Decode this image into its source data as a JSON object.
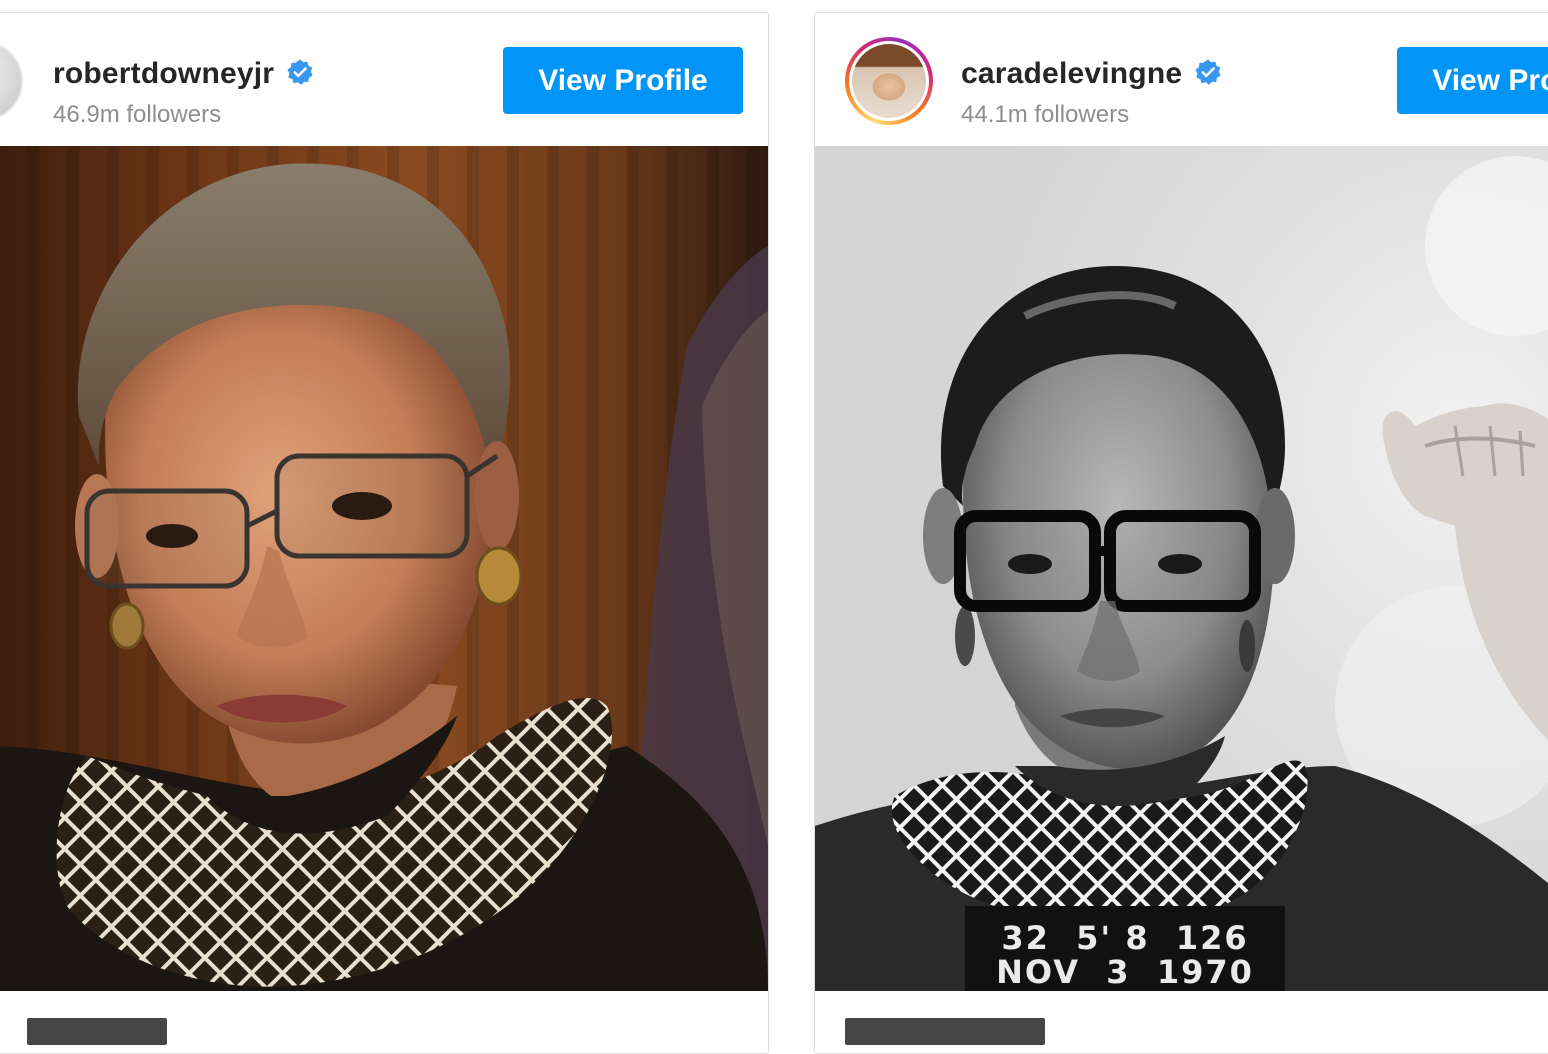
{
  "cards": [
    {
      "username": "robertdowneyjr",
      "verified": true,
      "followers": "46.9m followers",
      "button_label": "View Profile"
    },
    {
      "username": "caradelevingne",
      "verified": true,
      "followers": "44.1m followers",
      "button_label": "View Profile"
    }
  ],
  "colors": {
    "button": "#0095f6",
    "verified_badge": "#3897f0",
    "card_border": "#dbdbdb"
  },
  "photo_overlay_text": {
    "line1": "32  5' 8  126",
    "line2": "NOV  3  1970"
  }
}
